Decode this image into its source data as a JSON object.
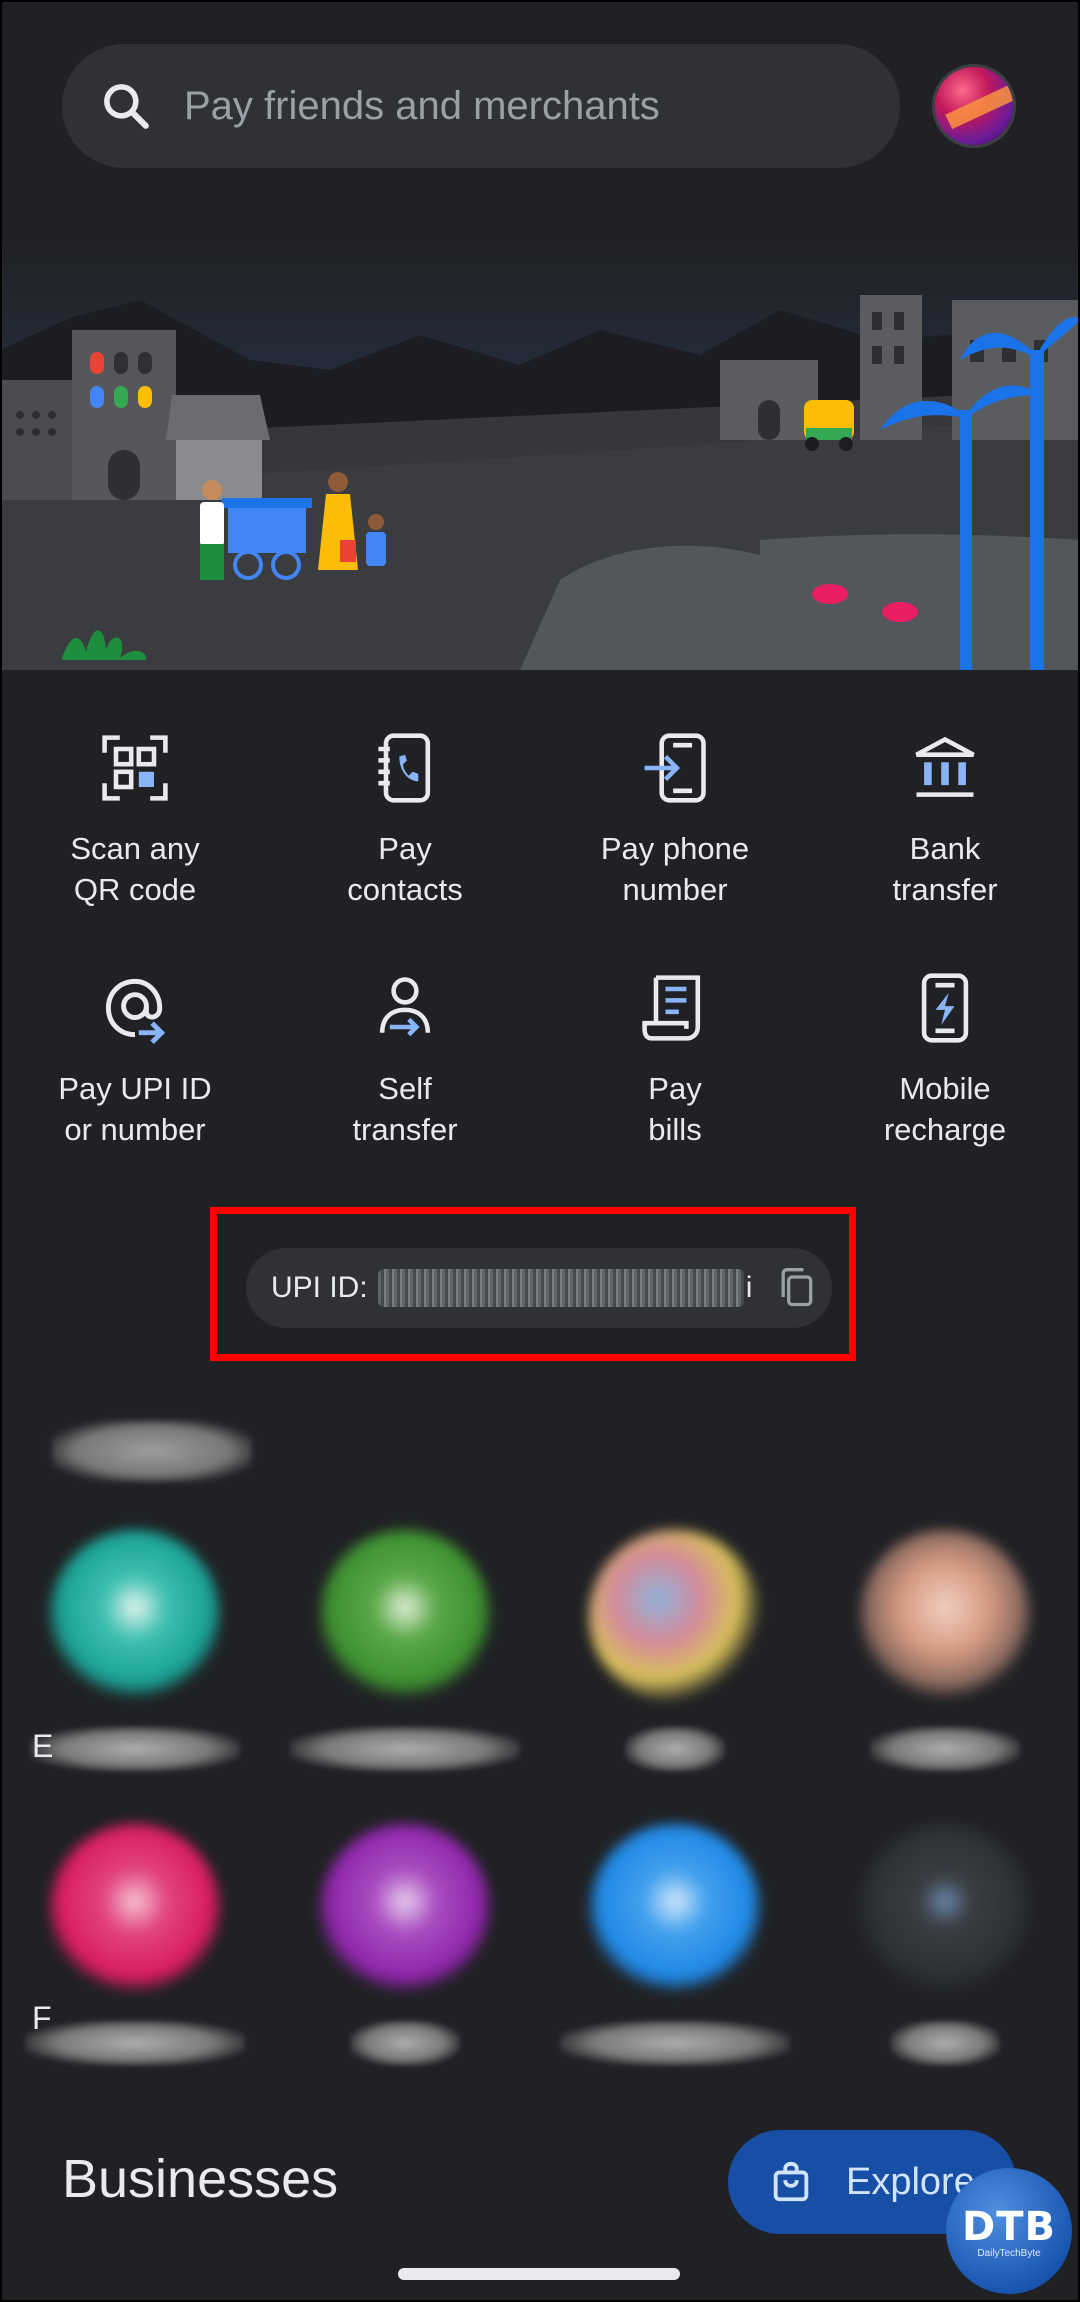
{
  "search": {
    "placeholder": "Pay friends and merchants"
  },
  "actions": [
    {
      "icon": "qr-scan-icon",
      "line1": "Scan any",
      "line2": "QR code"
    },
    {
      "icon": "contacts-icon",
      "line1": "Pay",
      "line2": "contacts"
    },
    {
      "icon": "phone-number-icon",
      "line1": "Pay phone",
      "line2": "number"
    },
    {
      "icon": "bank-icon",
      "line1": "Bank",
      "line2": "transfer"
    },
    {
      "icon": "at-sign-icon",
      "line1": "Pay UPI ID",
      "line2": "or number"
    },
    {
      "icon": "self-transfer-icon",
      "line1": "Self",
      "line2": "transfer"
    },
    {
      "icon": "bill-icon",
      "line1": "Pay",
      "line2": "bills"
    },
    {
      "icon": "mobile-recharge-icon",
      "line1": "Mobile",
      "line2": "recharge"
    }
  ],
  "upi": {
    "label": "UPI ID:",
    "tail": "i"
  },
  "people": {
    "stray_letters": [
      "E",
      "F"
    ],
    "colors": [
      "#19a093",
      "#3c8f2f",
      "#d8c25a",
      "#d59a80",
      "#d81b60",
      "#8e24aa",
      "#1e88e5",
      "#2c2f33"
    ]
  },
  "businesses": {
    "title": "Businesses",
    "explore_label": "Explore"
  },
  "watermark": {
    "main": "DTB",
    "sub": "DailyTechByte"
  },
  "colors": {
    "background": "#202124",
    "surface": "#303134",
    "accent": "#8ab4f8",
    "highlight": "#ff0000",
    "explore_bg": "#174ea6"
  }
}
